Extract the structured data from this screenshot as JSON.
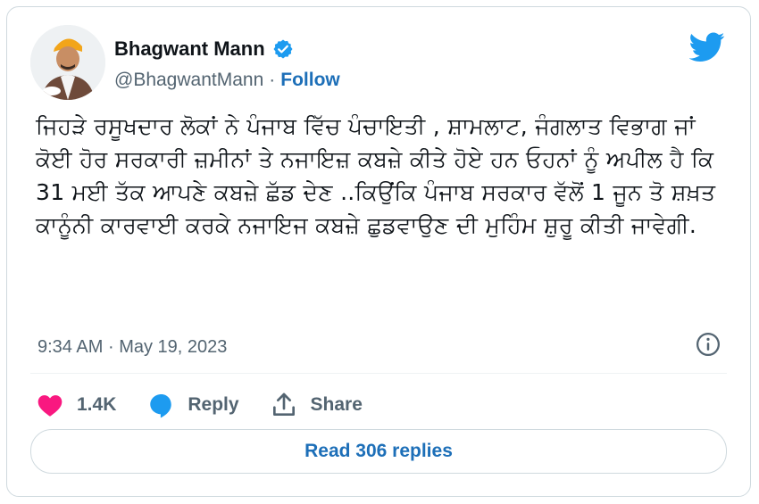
{
  "author": {
    "name": "Bhagwant Mann",
    "handle": "@BhagwantMann",
    "separator": "·",
    "follow_label": "Follow"
  },
  "tweet": {
    "text": "ਜਿਹੜੇ ਰਸੂਖਦਾਰ ਲੋਕਾਂ ਨੇ ਪੰਜਾਬ ਵਿੱਚ ਪੰਚਾਇਤੀ , ਸ਼ਾਮਲਾਟ, ਜੰਗਲਾਤ ਵਿਭਾਗ ਜਾਂ ਕੋਈ ਹੋਰ ਸਰਕਾਰੀ ਜ਼ਮੀਨਾਂ ਤੇ ਨਜਾਇਜ਼ ਕਬਜ਼ੇ ਕੀਤੇ ਹੋਏ ਹਨ ਓਹਨਾਂ ਨੂੰ ਅਪੀਲ ਹੈ ਕਿ 31 ਮਈ ਤੱਕ ਆਪਣੇ ਕਬਜ਼ੇ ਛੱਡ ਦੇਣ ..ਕਿਉਂਕਿ ਪੰਜਾਬ ਸਰਕਾਰ ਵੱਲੋਂ 1 ਜੂਨ ਤੋ ਸ਼ਖ਼ਤ ਕਾਨੂੰਨੀ ਕਾਰਵਾਈ ਕਰਕੇ ਨਜਾਇਜ ਕਬਜ਼ੇ ਛੁਡਵਾਉਣ ਦੀ ਮੁਹਿੰਮ ਸ਼ੁਰੂ ਕੀਤੀ ਜਾਵੇਗੀ.",
    "time": "9:34 AM",
    "date_separator": "·",
    "date": "May 19, 2023"
  },
  "actions": {
    "likes": "1.4K",
    "reply_label": "Reply",
    "share_label": "Share"
  },
  "read_replies_label": "Read 306 replies",
  "colors": {
    "twitter_blue": "#1d9bf0",
    "link_blue": "#1d6fb8",
    "heart_pink": "#f91880",
    "muted": "#536471",
    "border": "#cfd9de"
  },
  "icons": [
    "verified-badge-icon",
    "twitter-bird-icon",
    "info-icon",
    "heart-icon",
    "reply-bubble-icon",
    "share-icon"
  ]
}
